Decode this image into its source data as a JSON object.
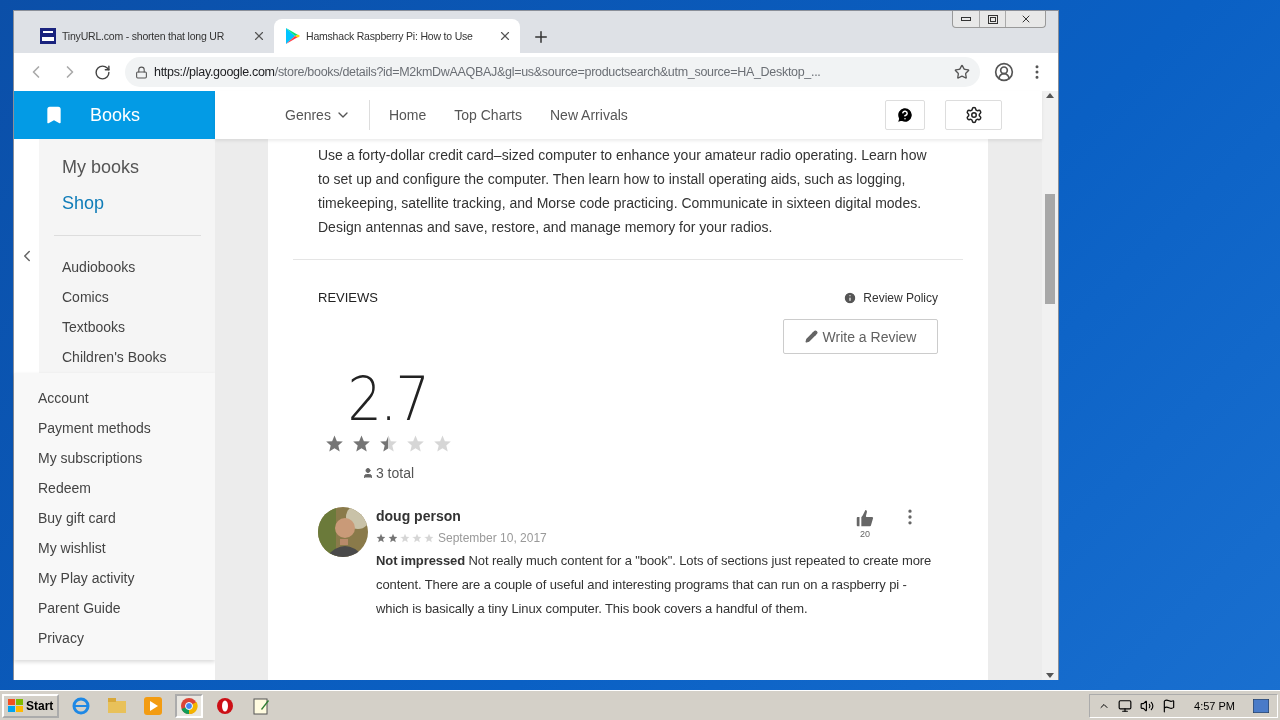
{
  "browser": {
    "tabs": [
      {
        "title": "TinyURL.com - shorten that long UR",
        "selected": false,
        "kind": "tinyurl"
      },
      {
        "title": "Hamshack Raspberry Pi: How to Use",
        "selected": true,
        "kind": "play"
      }
    ],
    "url_host": "https://play.google.com",
    "url_path": "/store/books/details?id=M2kmDwAAQBAJ&gl=us&source=productsearch&utm_source=HA_Desktop_..."
  },
  "store": {
    "title": "Books"
  },
  "nav": [
    {
      "label": "Genres",
      "kind": "dropdown"
    },
    {
      "label": "Home",
      "kind": "link"
    },
    {
      "label": "Top Charts",
      "kind": "link"
    },
    {
      "label": "New Arrivals",
      "kind": "link"
    }
  ],
  "sidebar": {
    "main": [
      {
        "label": "My books",
        "selected": false
      },
      {
        "label": "Shop",
        "selected": true
      }
    ],
    "categories": [
      "Audiobooks",
      "Comics",
      "Textbooks",
      "Children's Books"
    ],
    "account": [
      "Account",
      "Payment methods",
      "My subscriptions",
      "Redeem",
      "Buy gift card",
      "My wishlist",
      "My Play activity",
      "Parent Guide",
      "Privacy"
    ]
  },
  "description": [
    "Use a forty-dollar credit card–sized computer to enhance your amateur radio operating. Learn how",
    "to set up and configure the computer. Then learn how to install operating aids, such as logging,",
    "timekeeping, satellite tracking, and Morse code practicing. Communicate in sixteen digital modes.",
    "Design antennas and save, restore, and manage memory for your radios."
  ],
  "reviews": {
    "heading": "REVIEWS",
    "policy": "Review Policy",
    "write": "Write a Review",
    "score": "2.7",
    "stars": 2.5,
    "total": "3 total",
    "items": [
      {
        "author": "doug person",
        "stars": 2,
        "date": "September 10, 2017",
        "likes": "20",
        "text": "**Not impressed** Not really much content for a \"book\". Lots of sections just repeated to create more content. There are a couple of useful and interesting programs that can run on a raspberry pi - which is basically a tiny Linux computer. This book covers a handful of them."
      }
    ]
  },
  "taskbar": {
    "start": "Start",
    "clock": "4:57 PM"
  }
}
